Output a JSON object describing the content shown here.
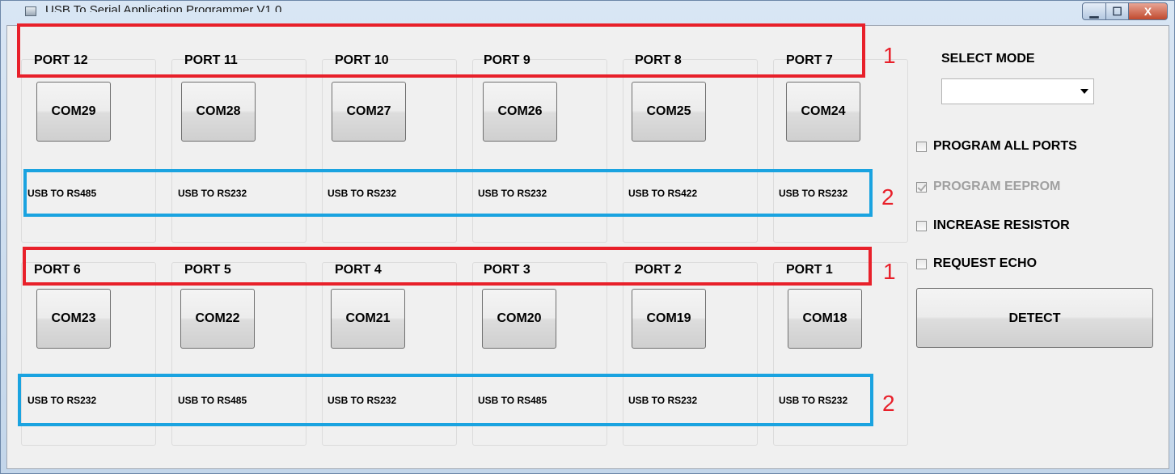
{
  "window": {
    "title": "USB To Serial Application Programmer V1.0",
    "controls": {
      "minimize": "▁",
      "maximize": "☐",
      "close": "X"
    }
  },
  "ports_top": [
    {
      "port": "PORT 12",
      "com": "COM29",
      "type": "USB TO RS485"
    },
    {
      "port": "PORT 11",
      "com": "COM28",
      "type": "USB TO RS232"
    },
    {
      "port": "PORT 10",
      "com": "COM27",
      "type": "USB TO RS232"
    },
    {
      "port": "PORT 9",
      "com": "COM26",
      "type": "USB TO RS232"
    },
    {
      "port": "PORT 8",
      "com": "COM25",
      "type": "USB TO RS422"
    },
    {
      "port": "PORT 7",
      "com": "COM24",
      "type": "USB TO RS232"
    }
  ],
  "ports_bottom": [
    {
      "port": "PORT 6",
      "com": "COM23",
      "type": "USB TO RS232"
    },
    {
      "port": "PORT 5",
      "com": "COM22",
      "type": "USB TO RS485"
    },
    {
      "port": "PORT 4",
      "com": "COM21",
      "type": "USB TO RS232"
    },
    {
      "port": "PORT 3",
      "com": "COM20",
      "type": "USB TO RS485"
    },
    {
      "port": "PORT 2",
      "com": "COM19",
      "type": "USB TO RS232"
    },
    {
      "port": "PORT 1",
      "com": "COM18",
      "type": "USB TO RS232"
    }
  ],
  "sidebar": {
    "select_mode_label": "SELECT MODE",
    "select_mode_value": "",
    "checkboxes": [
      {
        "label": "PROGRAM ALL PORTS",
        "checked": false,
        "enabled": true
      },
      {
        "label": "PROGRAM EEPROM",
        "checked": true,
        "enabled": false
      },
      {
        "label": "INCREASE RESISTOR",
        "checked": false,
        "enabled": true
      },
      {
        "label": "REQUEST ECHO",
        "checked": false,
        "enabled": true
      }
    ],
    "detect_label": "DETECT"
  },
  "annotations": {
    "red_number": "1",
    "blue_number": "2",
    "red_color": "#e8202a",
    "blue_color": "#1aa3e0"
  }
}
